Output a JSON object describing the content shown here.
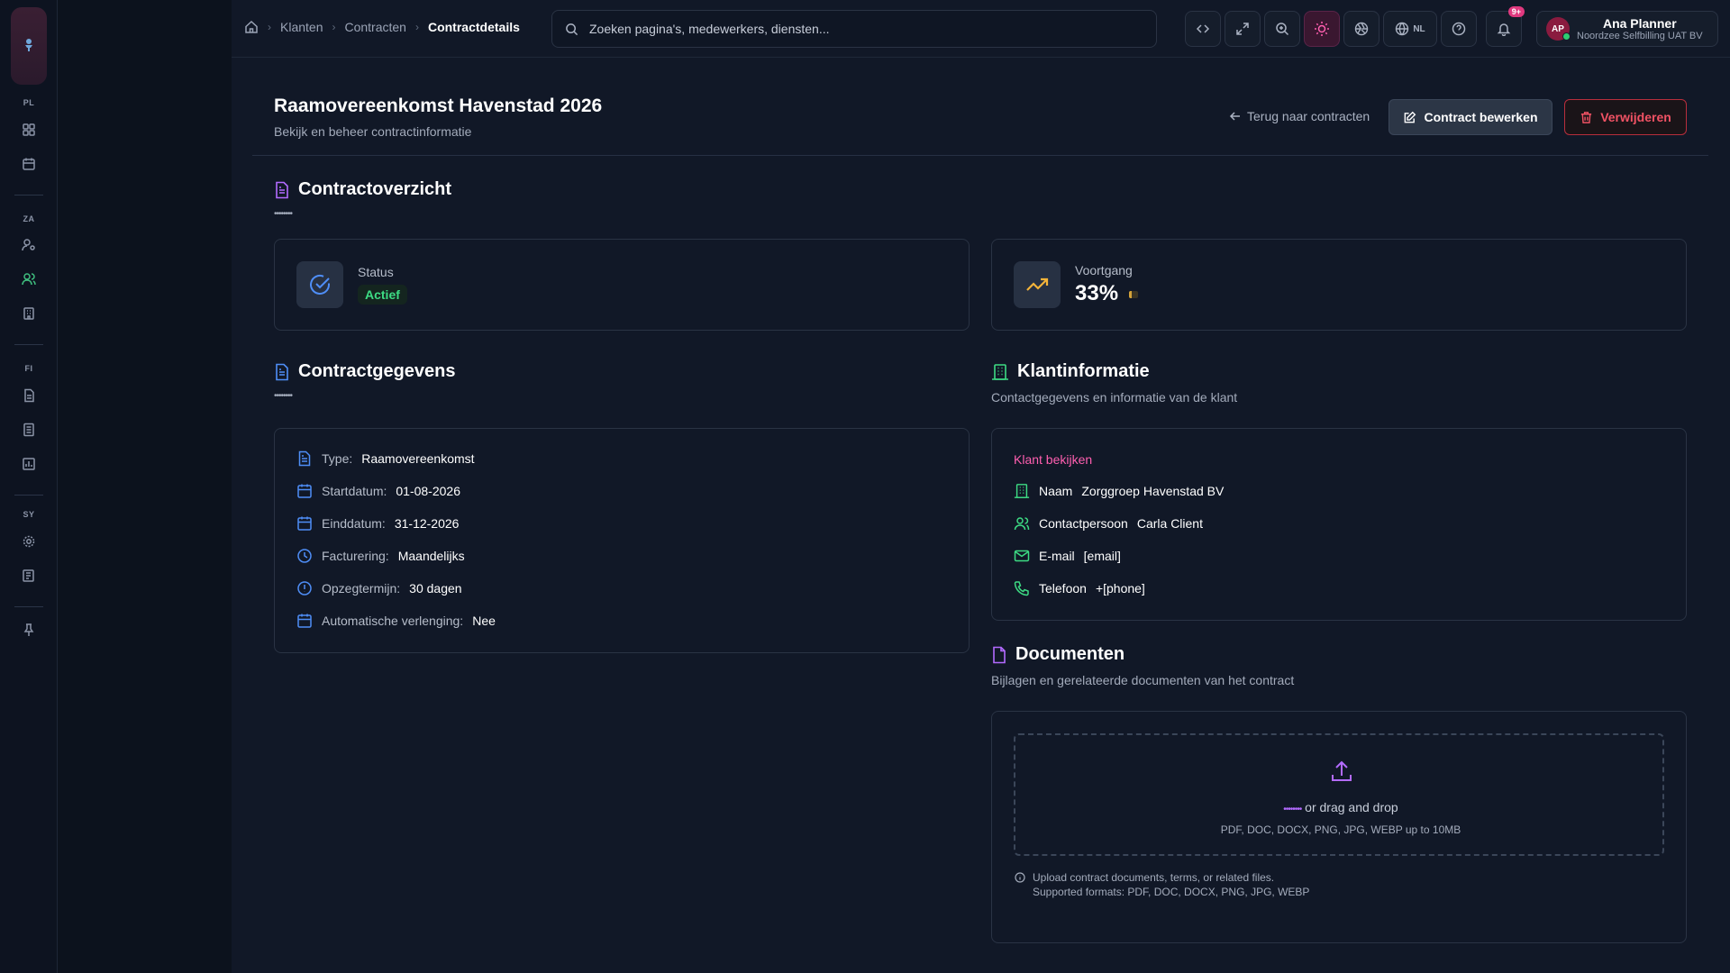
{
  "breadcrumb": {
    "items": [
      "Klanten",
      "Contracten"
    ],
    "current": "Contractdetails"
  },
  "search": {
    "placeholder": "Zoeken pagina's, medewerkers, diensten..."
  },
  "topbar": {
    "language": "NL",
    "notification_count": "9+"
  },
  "user": {
    "initials": "AP",
    "name": "Ana Planner",
    "org": "Noordzee Selfbilling UAT BV"
  },
  "sidebar": {
    "sections": [
      "PL",
      "ZA",
      "FI",
      "SY"
    ]
  },
  "header": {
    "title": "Raamovereenkomst Havenstad 2026",
    "subtitle": "Bekijk en beheer contractinformatie",
    "back_label": "Terug naar contracten",
    "edit_label": "Contract bewerken",
    "delete_label": "Verwijderen"
  },
  "overview": {
    "title": "Contractoverzicht",
    "dots": "••••••••",
    "status_label": "Status",
    "status_value": "Actief",
    "progress_label": "Voortgang",
    "progress_value": "33%",
    "progress_fraction": 0.33
  },
  "details": {
    "title": "Contractgegevens",
    "dots": "••••••••",
    "rows": [
      {
        "label": "Type:",
        "value": "Raamovereenkomst"
      },
      {
        "label": "Startdatum:",
        "value": "01-08-2026"
      },
      {
        "label": "Einddatum:",
        "value": "31-12-2026"
      },
      {
        "label": "Facturering:",
        "value": "Maandelijks"
      },
      {
        "label": "Opzegtermijn:",
        "value": "30 dagen"
      },
      {
        "label": "Automatische verlenging:",
        "value": "Nee"
      }
    ]
  },
  "customer": {
    "title": "Klantinformatie",
    "description": "Contactgegevens en informatie van de klant",
    "view_link": "Klant bekijken",
    "rows": [
      {
        "label": "Naam",
        "value": "Zorggroep Havenstad BV"
      },
      {
        "label": "Contactpersoon",
        "value": "Carla Client"
      },
      {
        "label": "E-mail",
        "value": "[email]"
      },
      {
        "label": "Telefoon",
        "value": "+[phone]"
      }
    ]
  },
  "documents": {
    "title": "Documenten",
    "description": "Bijlagen en gerelateerde documenten van het contract",
    "upload_link": "••••••••",
    "drag_text": " or drag and drop",
    "formats": "PDF, DOC, DOCX, PNG, JPG, WEBP up to 10MB",
    "help_line1": "Upload contract documents, terms, or related files.",
    "help_line2": "Supported formats: PDF, DOC, DOCX, PNG, JPG, WEBP"
  }
}
